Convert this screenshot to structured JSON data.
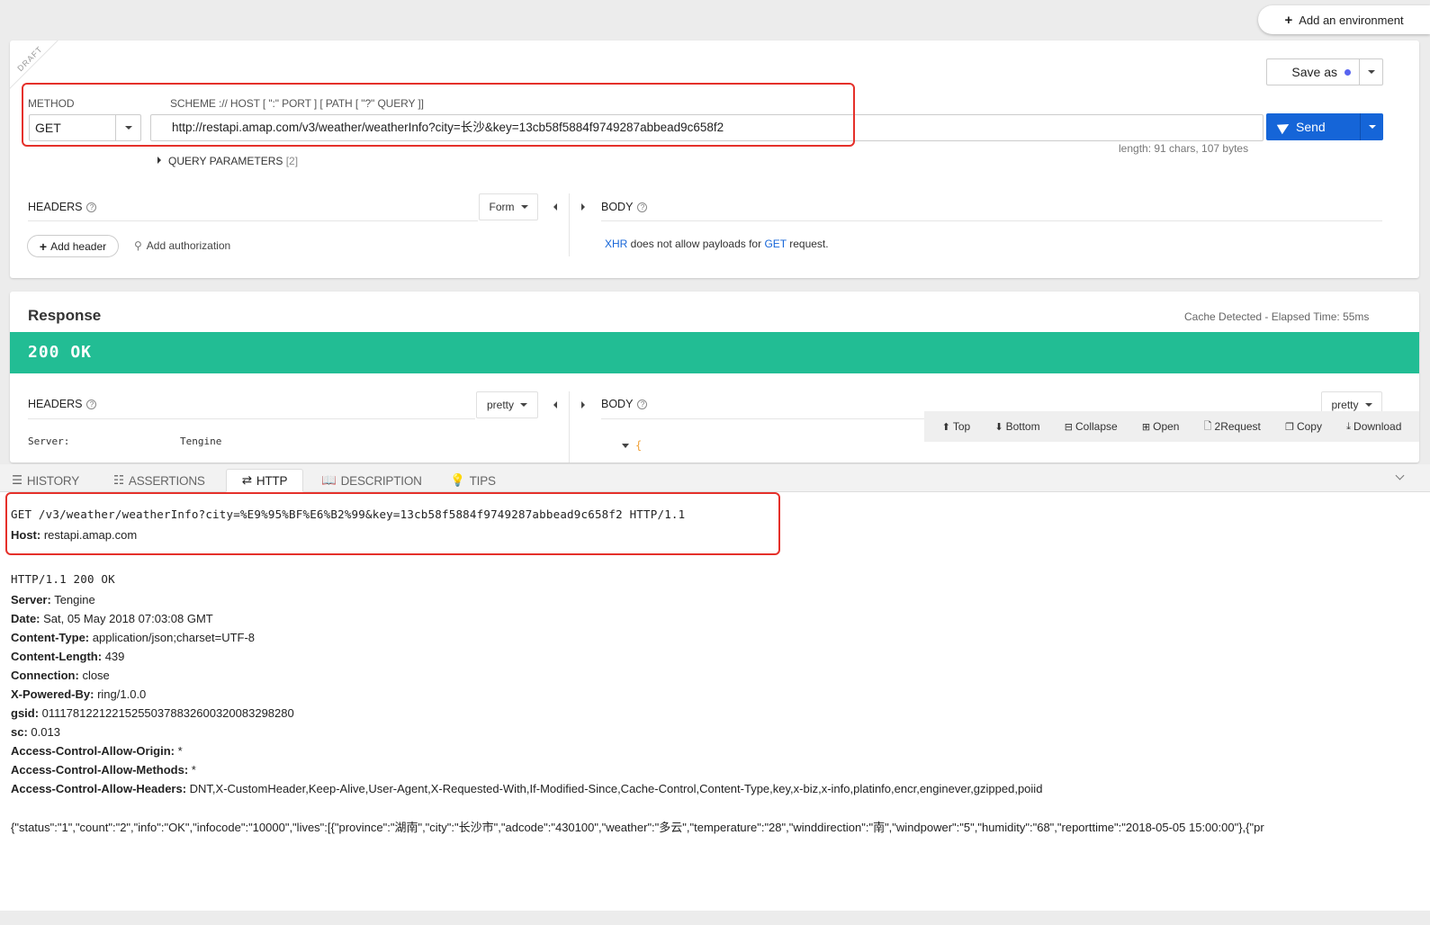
{
  "environment": {
    "add_label": "Add an environment"
  },
  "request": {
    "draft_label": "DRAFT",
    "method_label": "METHOD",
    "method_value": "GET",
    "url_label": "SCHEME :// HOST [ \":\" PORT ] [ PATH [ \"?\" QUERY ]]",
    "url_value": "http://restapi.amap.com/v3/weather/weatherInfo?city=长沙&key=13cb58f5884f9749287abbead9c658f2",
    "save_as_label": "Save as",
    "send_label": "Send",
    "length_info": "length: 91 chars, 107 bytes",
    "query_params_label": "QUERY PARAMETERS",
    "query_params_count": "[2]",
    "headers_label": "HEADERS",
    "headers_mode": "Form",
    "body_label": "BODY",
    "add_header_label": "Add header",
    "add_authorization_label": "Add authorization",
    "body_msg": {
      "xhr": "XHR",
      "mid": " does not allow payloads for ",
      "method": "GET",
      "end": " request."
    }
  },
  "response": {
    "title": "Response",
    "meta": "Cache Detected - Elapsed Time: 55ms",
    "status": "200 OK",
    "headers_label": "HEADERS",
    "headers_mode": "pretty",
    "body_label": "BODY",
    "body_mode": "pretty",
    "first_header": {
      "name": "Server:",
      "value": "Tengine"
    },
    "toolbar": [
      "Top",
      "Bottom",
      "Collapse",
      "Open",
      "2Request",
      "Copy",
      "Download"
    ],
    "json_open": "{"
  },
  "bottom_tabs": [
    {
      "label": "HISTORY",
      "icon": "list-icon"
    },
    {
      "label": "ASSERTIONS",
      "icon": "checklist-icon"
    },
    {
      "label": "HTTP",
      "icon": "exchange-icon",
      "active": true
    },
    {
      "label": "DESCRIPTION",
      "icon": "book-icon"
    },
    {
      "label": "TIPS",
      "icon": "lightbulb-icon"
    }
  ],
  "http": {
    "request_line": "GET /v3/weather/weatherInfo?city=%E9%95%BF%E6%B2%99&key=13cb58f5884f9749287abbead9c658f2 HTTP/1.1",
    "host": {
      "name": "Host:",
      "value": " restapi.amap.com"
    },
    "status_line": "HTTP/1.1 200 OK",
    "headers": [
      {
        "name": "Server:",
        "value": " Tengine"
      },
      {
        "name": "Date:",
        "value": " Sat, 05 May 2018 07:03:08 GMT"
      },
      {
        "name": "Content-Type:",
        "value": " application/json;charset=UTF-8"
      },
      {
        "name": "Content-Length:",
        "value": " 439"
      },
      {
        "name": "Connection:",
        "value": " close"
      },
      {
        "name": "X-Powered-By:",
        "value": " ring/1.0.0"
      },
      {
        "name": "gsid:",
        "value": " 011178122122152550378832600320083298280"
      },
      {
        "name": "sc:",
        "value": " 0.013"
      },
      {
        "name": "Access-Control-Allow-Origin:",
        "value": " *"
      },
      {
        "name": "Access-Control-Allow-Methods:",
        "value": " *"
      },
      {
        "name": "Access-Control-Allow-Headers:",
        "value": " DNT,X-CustomHeader,Keep-Alive,User-Agent,X-Requested-With,If-Modified-Since,Cache-Control,Content-Type,key,x-biz,x-info,platinfo,encr,enginever,gzipped,poiid"
      }
    ],
    "body": "{\"status\":\"1\",\"count\":\"2\",\"info\":\"OK\",\"infocode\":\"10000\",\"lives\":[{\"province\":\"湖南\",\"city\":\"长沙市\",\"adcode\":\"430100\",\"weather\":\"多云\",\"temperature\":\"28\",\"winddirection\":\"南\",\"windpower\":\"5\",\"humidity\":\"68\",\"reporttime\":\"2018-05-05 15:00:00\"},{\"pr"
  },
  "colors": {
    "accent": "#1565d8",
    "status_ok": "#22bd94",
    "highlight": "#e5302a"
  }
}
